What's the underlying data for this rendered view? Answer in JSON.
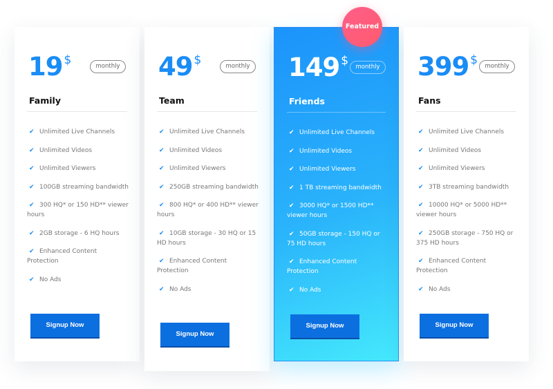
{
  "currency": "$",
  "featured_badge": "Featured",
  "plans": [
    {
      "price": "19",
      "period": "monthly",
      "name": "Family",
      "features": [
        "Unlimited Live Channels",
        "Unlimited Videos",
        "Unlimited Viewers",
        "100GB streaming bandwidth",
        "300 HQ* or 150 HD** viewer hours",
        "2GB storage - 6 HQ hours",
        "Enhanced Content Protection",
        "No Ads"
      ],
      "button": "Signup Now"
    },
    {
      "price": "49",
      "period": "monthly",
      "name": "Team",
      "features": [
        "Unlimited Live Channels",
        "Unlimited Videos",
        "Unlimited Viewers",
        "250GB streaming bandwidth",
        "800 HQ* or 400 HD** viewer hours",
        "10GB storage - 30 HQ or 15 HD hours",
        "Enhanced Content Protection",
        "No Ads"
      ],
      "button": "Signup Now"
    },
    {
      "price": "149",
      "period": "monthly",
      "name": "Friends",
      "features": [
        "Unlimited Live Channels",
        "Unlimited Videos",
        "Unlimited Viewers",
        "1 TB streaming bandwidth",
        "3000 HQ* or 1500 HD** viewer hours",
        "50GB storage - 150 HQ or 75 HD hours",
        "Enhanced Content Protection",
        "No Ads"
      ],
      "button": "Signup Now"
    },
    {
      "price": "399",
      "period": "monthly",
      "name": "Fans",
      "features": [
        "Unlimited Live Channels",
        "Unlimited Videos",
        "Unlimited Viewers",
        "3TB streaming bandwidth",
        "10000 HQ* or 5000 HD** viewer hours",
        "250GB storage - 750 HQ or 375 HD hours",
        "Enhanced Content Protection",
        "No Ads"
      ],
      "button": "Signup Now"
    }
  ],
  "colors": {
    "accent": "#1a8cf5",
    "button": "#0c6fe0",
    "badge": "#ff5f7a"
  }
}
